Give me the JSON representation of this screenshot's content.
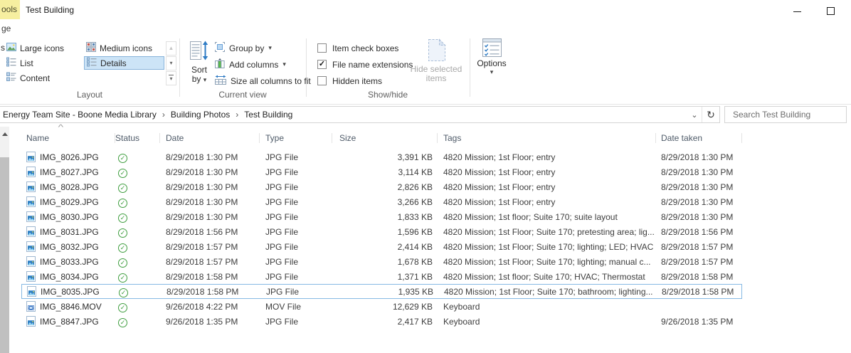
{
  "colors": {
    "selection_border": "#86b9e4",
    "details_selected_bg": "#cce4f7",
    "details_selected_border": "#88b3da",
    "contextual_tab_yellow": "#f6efa0",
    "sync_status_green": "#3f9e3f"
  },
  "icons": {
    "check": "✓",
    "refresh": "↻",
    "breadcrumb_separator": "›",
    "dropdown_chevron": "⌄",
    "caret": "▾",
    "gallery_down": "▾",
    "sort_ascending": "^"
  },
  "window": {
    "title": "Test Building",
    "contextual_tab_fragment": "ools",
    "ribbon_tab_fragment": "ge"
  },
  "ribbon": {
    "layout": {
      "label": "Layout",
      "clipped_item_fragment": "s",
      "views": [
        {
          "label": "Large icons",
          "selected": false
        },
        {
          "label": "List",
          "selected": false
        },
        {
          "label": "Content",
          "selected": false
        },
        {
          "label": "Medium icons",
          "selected": false
        },
        {
          "label": "Details",
          "selected": true
        }
      ]
    },
    "current_view": {
      "label": "Current view",
      "sort_by_label": "Sort by",
      "group_by_label": "Group by",
      "add_columns_label": "Add columns",
      "size_columns_label": "Size all columns to fit"
    },
    "show_hide": {
      "label": "Show/hide",
      "checkboxes": [
        {
          "label": "Item check boxes",
          "checked": false
        },
        {
          "label": "File name extensions",
          "checked": true
        },
        {
          "label": "Hidden items",
          "checked": false
        }
      ],
      "hide_selected_label": "Hide selected items",
      "hide_selected_enabled": false
    },
    "options_label": "Options"
  },
  "address_bar": {
    "breadcrumbs": [
      "Energy Team Site - Boone Media Library",
      "Building Photos",
      "Test Building"
    ],
    "search_placeholder": "Search Test Building"
  },
  "table": {
    "columns": [
      {
        "key": "name",
        "label": "Name"
      },
      {
        "key": "status",
        "label": "Status"
      },
      {
        "key": "date",
        "label": "Date"
      },
      {
        "key": "type",
        "label": "Type"
      },
      {
        "key": "size",
        "label": "Size"
      },
      {
        "key": "tags",
        "label": "Tags"
      },
      {
        "key": "taken",
        "label": "Date taken"
      }
    ],
    "sorted_by": "Name",
    "sort_direction": "ascending",
    "rows": [
      {
        "name": "IMG_8026.JPG",
        "icon": "jpg-file-icon",
        "status": "synced",
        "date": "8/29/2018 1:30 PM",
        "type": "JPG File",
        "size": "3,391 KB",
        "tags": "4820 Mission; 1st Floor; entry",
        "taken": "8/29/2018 1:30 PM",
        "selected": false
      },
      {
        "name": "IMG_8027.JPG",
        "icon": "jpg-file-icon",
        "status": "synced",
        "date": "8/29/2018 1:30 PM",
        "type": "JPG File",
        "size": "3,114 KB",
        "tags": "4820 Mission; 1st Floor; entry",
        "taken": "8/29/2018 1:30 PM",
        "selected": false
      },
      {
        "name": "IMG_8028.JPG",
        "icon": "jpg-file-icon",
        "status": "synced",
        "date": "8/29/2018 1:30 PM",
        "type": "JPG File",
        "size": "2,826 KB",
        "tags": "4820 Mission; 1st Floor; entry",
        "taken": "8/29/2018 1:30 PM",
        "selected": false
      },
      {
        "name": "IMG_8029.JPG",
        "icon": "jpg-file-icon",
        "status": "synced",
        "date": "8/29/2018 1:30 PM",
        "type": "JPG File",
        "size": "3,266 KB",
        "tags": "4820 Mission; 1st Floor; entry",
        "taken": "8/29/2018 1:30 PM",
        "selected": false
      },
      {
        "name": "IMG_8030.JPG",
        "icon": "jpg-file-icon",
        "status": "synced",
        "date": "8/29/2018 1:30 PM",
        "type": "JPG File",
        "size": "1,833 KB",
        "tags": "4820 Mission; 1st floor; Suite 170; suite layout",
        "taken": "8/29/2018 1:30 PM",
        "selected": false
      },
      {
        "name": "IMG_8031.JPG",
        "icon": "jpg-file-icon",
        "status": "synced",
        "date": "8/29/2018 1:56 PM",
        "type": "JPG File",
        "size": "1,596 KB",
        "tags": "4820 Mission; 1st Floor; Suite 170; pretesting area; lig...",
        "taken": "8/29/2018 1:56 PM",
        "selected": false
      },
      {
        "name": "IMG_8032.JPG",
        "icon": "jpg-file-icon",
        "status": "synced",
        "date": "8/29/2018 1:57 PM",
        "type": "JPG File",
        "size": "2,414 KB",
        "tags": "4820 Mission; 1st Floor; Suite 170; lighting; LED; HVAC",
        "taken": "8/29/2018 1:57 PM",
        "selected": false
      },
      {
        "name": "IMG_8033.JPG",
        "icon": "jpg-file-icon",
        "status": "synced",
        "date": "8/29/2018 1:57 PM",
        "type": "JPG File",
        "size": "1,678 KB",
        "tags": "4820 Mission; 1st Floor; Suite 170; lighting; manual c...",
        "taken": "8/29/2018 1:57 PM",
        "selected": false
      },
      {
        "name": "IMG_8034.JPG",
        "icon": "jpg-file-icon",
        "status": "synced",
        "date": "8/29/2018 1:58 PM",
        "type": "JPG File",
        "size": "1,371 KB",
        "tags": "4820 Mission; 1st floor; Suite 170; HVAC; Thermostat",
        "taken": "8/29/2018 1:58 PM",
        "selected": false
      },
      {
        "name": "IMG_8035.JPG",
        "icon": "jpg-file-icon",
        "status": "synced",
        "date": "8/29/2018 1:58 PM",
        "type": "JPG File",
        "size": "1,935 KB",
        "tags": "4820 Mission; 1st Floor; Suite 170; bathroom; lighting...",
        "taken": "8/29/2018 1:58 PM",
        "selected": true
      },
      {
        "name": "IMG_8846.MOV",
        "icon": "mov-file-icon",
        "status": "synced",
        "date": "9/26/2018 4:22 PM",
        "type": "MOV File",
        "size": "12,629 KB",
        "tags": "Keyboard",
        "taken": "",
        "selected": false
      },
      {
        "name": "IMG_8847.JPG",
        "icon": "jpg-file-icon",
        "status": "synced",
        "date": "9/26/2018 1:35 PM",
        "type": "JPG File",
        "size": "2,417 KB",
        "tags": "Keyboard",
        "taken": "9/26/2018 1:35 PM",
        "selected": false
      }
    ]
  }
}
